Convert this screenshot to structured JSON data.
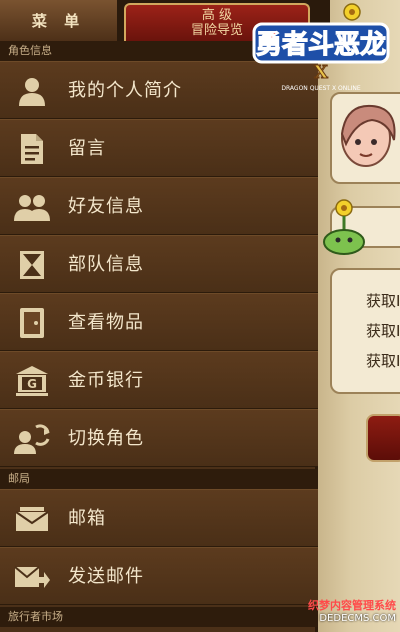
{
  "tabs": {
    "menu_label": "菜 单",
    "guide_line1": "高 级",
    "guide_line2": "冒险导览"
  },
  "sections": {
    "character_info": "角色信息",
    "mail": "邮局",
    "traveler_market": "旅行者市场"
  },
  "menu_items": [
    {
      "label": "我的个人简介",
      "icon": "person-icon"
    },
    {
      "label": "留言",
      "icon": "document-icon"
    },
    {
      "label": "好友信息",
      "icon": "friends-icon"
    },
    {
      "label": "部队信息",
      "icon": "hourglass-icon"
    },
    {
      "label": "查看物品",
      "icon": "item-door-icon"
    },
    {
      "label": "金币银行",
      "icon": "bank-icon"
    },
    {
      "label": "切换角色",
      "icon": "switch-character-icon"
    },
    {
      "label": "邮箱",
      "icon": "mailbox-icon"
    },
    {
      "label": "发送邮件",
      "icon": "send-mail-icon"
    }
  ],
  "right_panel": {
    "log_lines": [
      "获取I",
      "获取I",
      "获取I"
    ]
  },
  "logo": {
    "title": "勇者斗恶龙",
    "mark": "X",
    "subtitle": "DRAGON QUEST X ONLINE"
  },
  "watermark": {
    "line1": "织梦内容管理系统",
    "line2": "DEDECMS.COM"
  },
  "colors": {
    "drawer": "#4b3018",
    "text": "#f3e6cb",
    "accent_red": "#9c2218",
    "icon_tan": "#e0cfa8"
  }
}
